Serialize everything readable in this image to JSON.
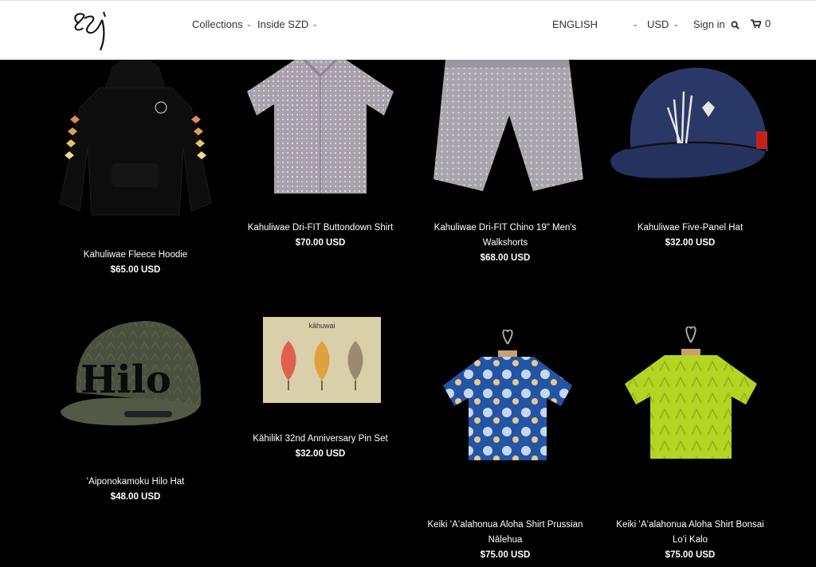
{
  "header": {
    "nav": [
      {
        "label": "Collections"
      },
      {
        "label": "Inside SZD"
      }
    ],
    "language": "ENGLISH",
    "currency": "USD",
    "sign_in": "Sign in",
    "cart_count": "0"
  },
  "products": [
    {
      "title": "Kahuliwae Fleece Hoodie",
      "price": "$65.00 USD"
    },
    {
      "title": "Kahuliwae Dri-FIT Buttondown Shirt",
      "price": "$70.00 USD"
    },
    {
      "title": "Kahuliwae Dri-FIT Chino 19\" Men's Walkshorts",
      "price": "$68.00 USD"
    },
    {
      "title": "Kahuliwae Five-Panel Hat",
      "price": "$32.00 USD"
    },
    {
      "title": "ʻAiponokamoku Hilo Hat",
      "price": "$48.00 USD"
    },
    {
      "title": "Kāhilikī 32nd Anniversary Pin Set",
      "price": "$32.00 USD"
    },
    {
      "title": "Keiki ʻAʻalahonua Aloha Shirt Prussian Nālehua",
      "price": "$75.00 USD"
    },
    {
      "title": "Keiki ʻAʻalahonua Aloha Shirt Bonsai Loʻi Kalo",
      "price": "$75.00 USD"
    }
  ],
  "hat_text": "Hilo",
  "pin_card_text": "kāhuwai"
}
